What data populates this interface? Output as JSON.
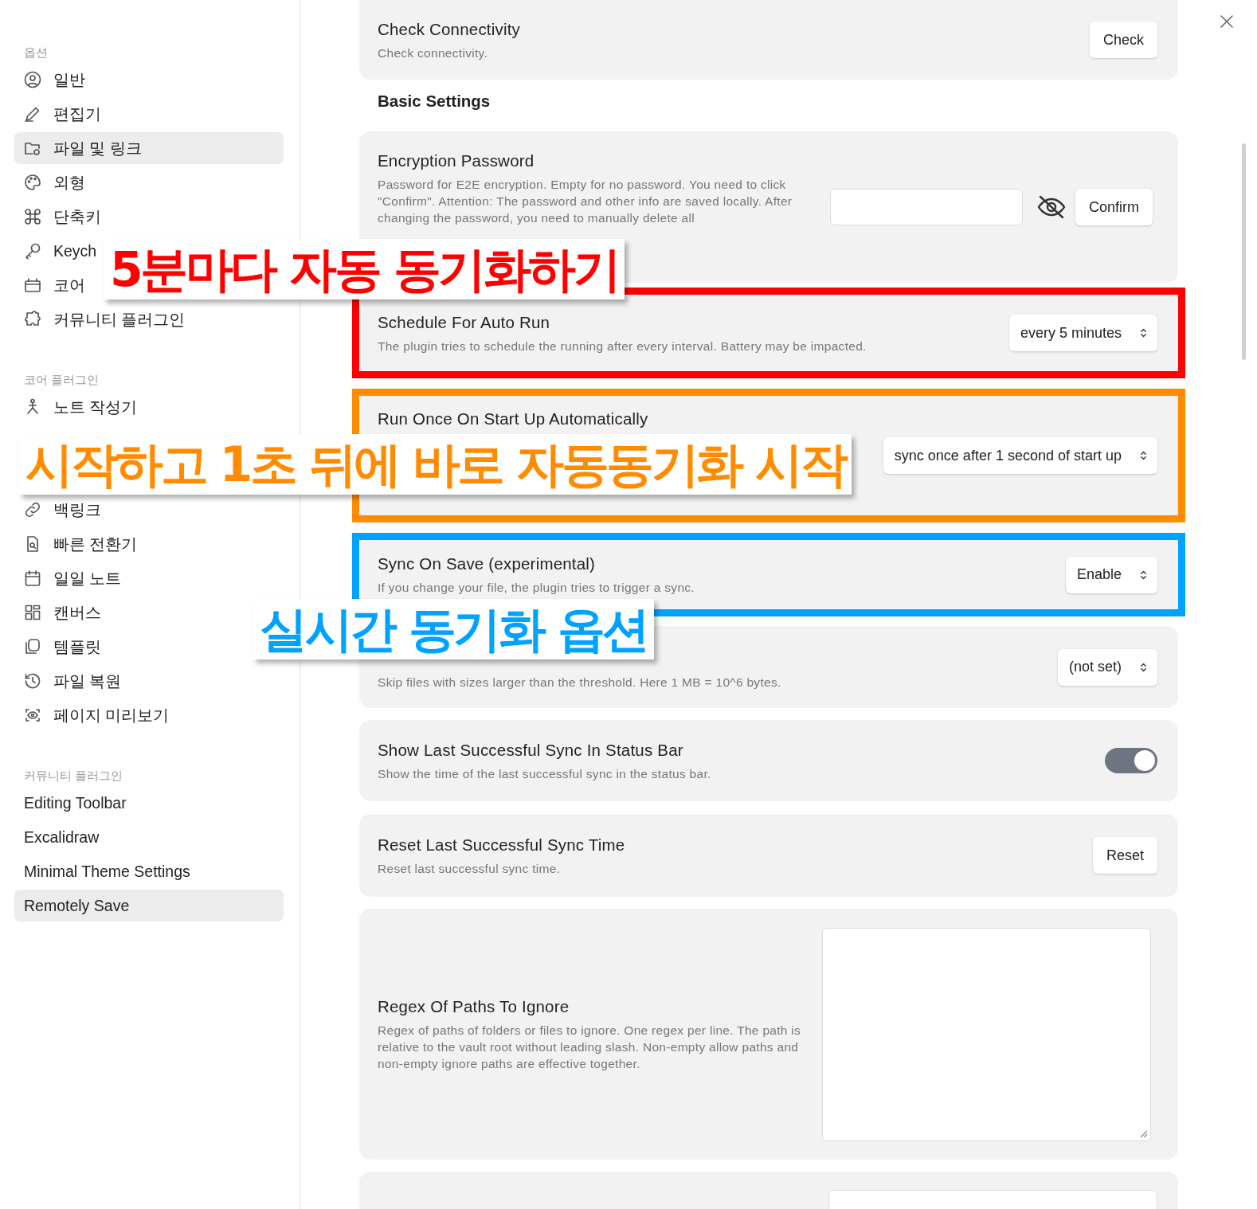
{
  "sidebar": {
    "sections": [
      {
        "heading": "옵션",
        "items": [
          {
            "label": "일반",
            "selected": false
          },
          {
            "label": "편집기",
            "selected": false
          },
          {
            "label": "파일 및 링크",
            "selected": true
          },
          {
            "label": "외형",
            "selected": false
          },
          {
            "label": "단축키",
            "selected": false
          },
          {
            "label": "Keych",
            "selected": false
          },
          {
            "label": "코어",
            "selected": false
          },
          {
            "label": "커뮤니티 플러그인",
            "selected": false
          }
        ]
      },
      {
        "heading": "코어 플러그인",
        "items": [
          {
            "label": "노트 작성기",
            "selected": false
          },
          {
            "label": "백링크",
            "selected": false
          },
          {
            "label": "빠른 전환기",
            "selected": false
          },
          {
            "label": "일일 노트",
            "selected": false
          },
          {
            "label": "캔버스",
            "selected": false
          },
          {
            "label": "템플릿",
            "selected": false
          },
          {
            "label": "파일 복원",
            "selected": false
          },
          {
            "label": "페이지 미리보기",
            "selected": false
          }
        ]
      },
      {
        "heading": "커뮤니티 플러그인",
        "items": [
          {
            "label": "Editing Toolbar",
            "selected": false
          },
          {
            "label": "Excalidraw",
            "selected": false
          },
          {
            "label": "Minimal Theme Settings",
            "selected": false
          },
          {
            "label": "Remotely Save",
            "selected": true
          }
        ]
      }
    ]
  },
  "settings": [
    {
      "kind": "button",
      "title": "Check Connectivity",
      "description": "Check connectivity.",
      "button": "Check"
    },
    {
      "kind": "heading",
      "title": "Basic Settings"
    },
    {
      "kind": "password",
      "title": "Encryption Password",
      "description": "Password for E2E encryption. Empty for no password. You need to click \"Confirm\". Attention: The password and other info are saved locally. After changing the password, you need to manually delete all",
      "button": "Confirm"
    },
    {
      "kind": "select",
      "title": "Schedule For Auto Run",
      "description": "The plugin tries to schedule the running after every interval. Battery may be impacted.",
      "value": "every 5 minutes",
      "color": "#ff0000"
    },
    {
      "kind": "select",
      "title": "Run Once On Start Up Automatically",
      "value": "sync once after 1 second of start up",
      "color": "#ff8c00"
    },
    {
      "kind": "select",
      "title": "Sync On Save (experimental)",
      "description": "If you change your file, the plugin tries to trigger a sync.",
      "value": "Enable",
      "color": "#00a2ff"
    },
    {
      "kind": "select",
      "description": "Skip files with sizes larger than the threshold. Here 1 MB = 10^6 bytes.",
      "value": "(not set)"
    },
    {
      "kind": "toggle",
      "title": "Show Last Successful Sync In Status Bar",
      "description": "Show the time of the last successful sync in the status bar.",
      "on": true
    },
    {
      "kind": "button",
      "title": "Reset Last Successful Sync Time",
      "description": "Reset last successful sync time.",
      "button": "Reset"
    },
    {
      "kind": "textarea",
      "title": "Regex Of Paths To Ignore",
      "description": "Regex of paths of folders or files to ignore. One regex per line. The path is relative to the vault root without leading slash. Non-empty allow paths and non-empty ignore paths are effective together."
    },
    {
      "kind": "cutoff"
    }
  ],
  "annotations": [
    {
      "text": "5분마다 자동 동기화하기",
      "color": "#ff0000"
    },
    {
      "text": "시작하고 1초 뒤에 바로 자동동기화 시작",
      "color": "#ff8c00"
    },
    {
      "text": "실시간 동기화 옵션",
      "color": "#00a2ff"
    }
  ]
}
